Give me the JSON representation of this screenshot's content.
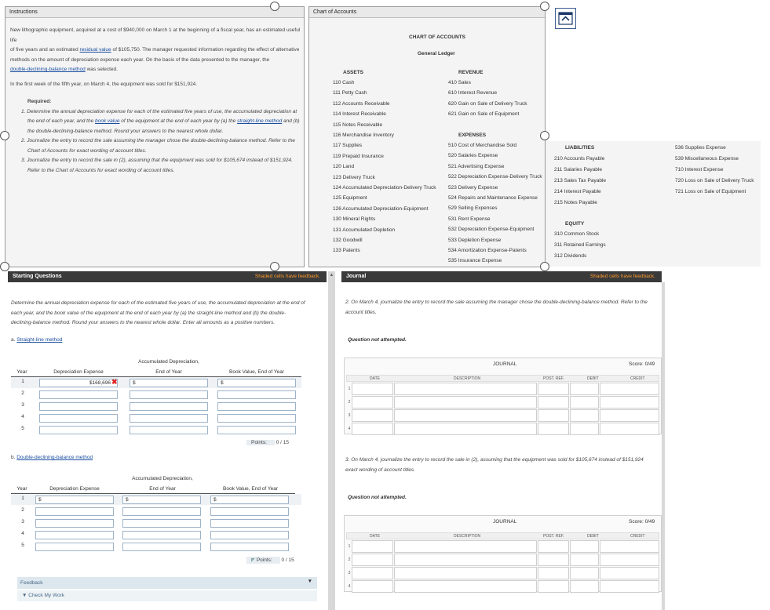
{
  "instructions": {
    "title": "Instructions",
    "para1": [
      "New lithographic equipment, acquired at a cost of $940,000 on March 1 at the beginning of a fiscal year, has an estimated useful life",
      "of five years and an estimated",
      "residual value",
      "of $105,750. The manager requested information regarding the effect of alternative",
      "methods on the amount of depreciation expense each year. On the basis of the data presented to the manager, the",
      "double-declining-balance method",
      "was selected."
    ],
    "para2": "In the first week of the fifth year, on March 4, the equipment was sold for $151,924.",
    "required": "Required:",
    "item1": [
      "1.",
      "Determine the annual depreciation expense for each of the estimated five years of use, the accumulated depreciation at",
      "the end of each year, and the",
      "book value",
      "of the equipment at the end of each year by (a) the",
      "straight-line method",
      "and (b)",
      "the double-declining-balance method. Round your answers to the nearest whole dollar."
    ],
    "item2": [
      "2.",
      "Journalize the entry to record the sale assuming the manager chose the double-declining-balance method. Refer to the",
      "Chart of Accounts for exact wording of account titles."
    ],
    "item3": [
      "3.",
      "Journalize the entry to record the sale in (2), assuming that the equipment was sold for $105,674 instead of $151,924.",
      "Refer to the Chart of Accounts for exact wording of account titles."
    ]
  },
  "coa": {
    "title": "Chart of Accounts",
    "heading": "CHART OF ACCOUNTS",
    "subheading": "General Ledger",
    "assets_h": "ASSETS",
    "assets": [
      "110 Cash",
      "111 Petty Cash",
      "112 Accounts Receivable",
      "114 Interest Receivable",
      "115 Notes Receivable",
      "116 Merchandise Inventory",
      "117 Supplies",
      "119 Prepaid Insurance",
      "120 Land",
      "123 Delivery Truck",
      "124 Accumulated Depreciation-Delivery Truck",
      "125 Equipment",
      "126 Accumulated Depreciation-Equipment",
      "130 Mineral Rights",
      "131 Accumulated Depletion",
      "132 Goodwill",
      "133 Patents"
    ],
    "revenue_h": "REVENUE",
    "revenue": [
      "410 Sales",
      "610 Interest Revenue",
      "620 Gain on Sale of Delivery Truck",
      "621 Gain on Sale of Equipment"
    ],
    "expenses_h": "EXPENSES",
    "expenses": [
      "510 Cost of Merchandise Sold",
      "520 Salaries Expense",
      "521 Advertising Expense",
      "522 Depreciation Expense-Delivery Truck",
      "523 Delivery Expense",
      "524 Repairs and Maintenance Expense",
      "529 Selling Expenses",
      "531 Rent Expense",
      "532 Depreciation Expense-Equipment",
      "533 Depletion Expense",
      "534 Amortization Expense-Patents",
      "535 Insurance Expense"
    ],
    "liabilities_h": "LIABILITIES",
    "liabilities": [
      "210 Accounts Payable",
      "211 Salaries Payable",
      "213 Sales Tax Payable",
      "214 Interest Payable",
      "215 Notes Payable"
    ],
    "equity_h": "EQUITY",
    "equity": [
      "310 Common Stock",
      "311 Retained Earnings",
      "312 Dividends"
    ],
    "more_expenses": [
      "536 Supplies Expense",
      "539 Miscellaneous Expense",
      "710 Interest Expense",
      "720 Loss on Sale of Delivery Truck",
      "721 Loss on Sale of Equipment"
    ]
  },
  "starting": {
    "bar_title": "Starting Questions",
    "bar_note": "Shaded cells have feedback.",
    "question": [
      "Determine the annual depreciation expense for each of the estimated five years of use, the accumulated depreciation at the end of",
      "each year, and the book value of the equipment at the end of each year by (a) the straight-line method and (b) the double-",
      "declining-balance method. Round your answers to the nearest whole dollar. Enter all amounts as a positive numbers."
    ],
    "a_label": "a.",
    "a_link": "Straight-line method",
    "b_label": "b.",
    "b_link": "Double-declining-balance method",
    "col_year": "Year",
    "col_dep": "Depreciation Expense",
    "col_acc1": "Accumulated Depreciation,",
    "col_acc2": "End of Year",
    "col_book": "Book Value, End of Year",
    "years": [
      "1",
      "2",
      "3",
      "4",
      "5"
    ],
    "a_row1_dep": "$168,696",
    "currency": "$",
    "points_label": "Points:",
    "points_a": "0 / 15",
    "points_b": "0 / 15",
    "feedback": "Feedback",
    "check": "Check My Work"
  },
  "journal": {
    "bar_title": "Journal",
    "bar_note": "Shaded cells have feedback.",
    "q2": [
      "2. On March 4, journalize the entry to record the sale assuming the manager chose the double-declining-balance method. Refer to the",
      "account titles."
    ],
    "q3": [
      "3. On March 4, journalize the entry to record the sale in (2), assuming that the equipment was sold for $105,674 instead of $151,924",
      "exact wording of account titles."
    ],
    "not_attempted": "Question not attempted.",
    "grid_title": "JOURNAL",
    "score": "Score: 0/49",
    "cols": [
      "DATE",
      "DESCRIPTION",
      "POST. REF.",
      "DEBIT",
      "CREDIT"
    ],
    "rows": [
      "1",
      "2",
      "3",
      "4"
    ]
  }
}
